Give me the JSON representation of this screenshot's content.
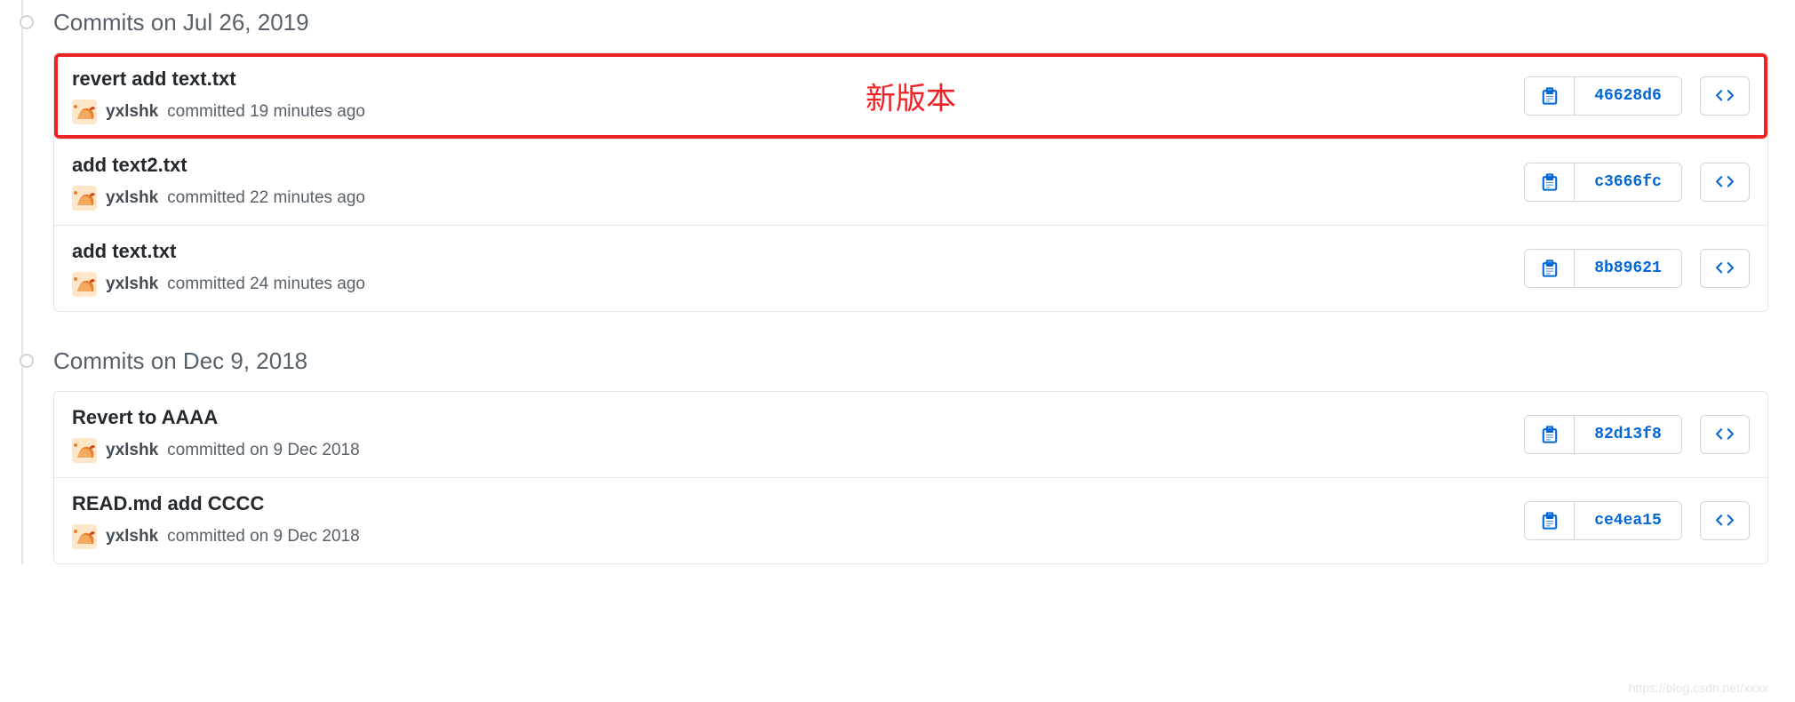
{
  "annotation_text": "新版本",
  "watermark": "https://blog.csdn.net/xxxx",
  "colors": {
    "highlight": "#ee2225",
    "link": "#0366d6"
  },
  "groups": [
    {
      "header": "Commits on Jul 26, 2019",
      "commits": [
        {
          "title": "revert add text.txt",
          "author": "yxlshk",
          "meta": "committed 19 minutes ago",
          "sha": "46628d6",
          "highlighted": true,
          "annotated": true
        },
        {
          "title": "add text2.txt",
          "author": "yxlshk",
          "meta": "committed 22 minutes ago",
          "sha": "c3666fc",
          "highlighted": false,
          "annotated": false
        },
        {
          "title": "add text.txt",
          "author": "yxlshk",
          "meta": "committed 24 minutes ago",
          "sha": "8b89621",
          "highlighted": false,
          "annotated": false
        }
      ]
    },
    {
      "header": "Commits on Dec 9, 2018",
      "commits": [
        {
          "title": "Revert to AAAA",
          "author": "yxlshk",
          "meta": "committed on 9 Dec 2018",
          "sha": "82d13f8",
          "highlighted": false,
          "annotated": false
        },
        {
          "title": "READ.md add CCCC",
          "author": "yxlshk",
          "meta": "committed on 9 Dec 2018",
          "sha": "ce4ea15",
          "highlighted": false,
          "annotated": false
        }
      ]
    }
  ]
}
